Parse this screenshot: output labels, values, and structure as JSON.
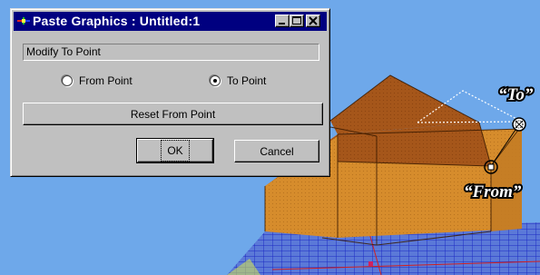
{
  "window": {
    "title": "Paste Graphics : Untitled:1",
    "minimize_icon": "minimize-icon",
    "maximize_icon": "maximize-icon",
    "close_icon": "close-icon"
  },
  "status": {
    "text": "Modify To Point"
  },
  "radios": {
    "from_label": "From Point",
    "from_selected": false,
    "to_label": "To Point",
    "to_selected": true
  },
  "buttons": {
    "reset_label": "Reset From Point",
    "ok_label": "OK",
    "cancel_label": "Cancel"
  },
  "scene": {
    "to_label": "“To”",
    "from_label": "“From”",
    "colors": {
      "sky": "#6ea8ea",
      "house_wall": "#d48a2a",
      "house_roof": "#a85614",
      "grid": "#2a3ad0",
      "grid_floor": "#5f7fd6"
    }
  }
}
